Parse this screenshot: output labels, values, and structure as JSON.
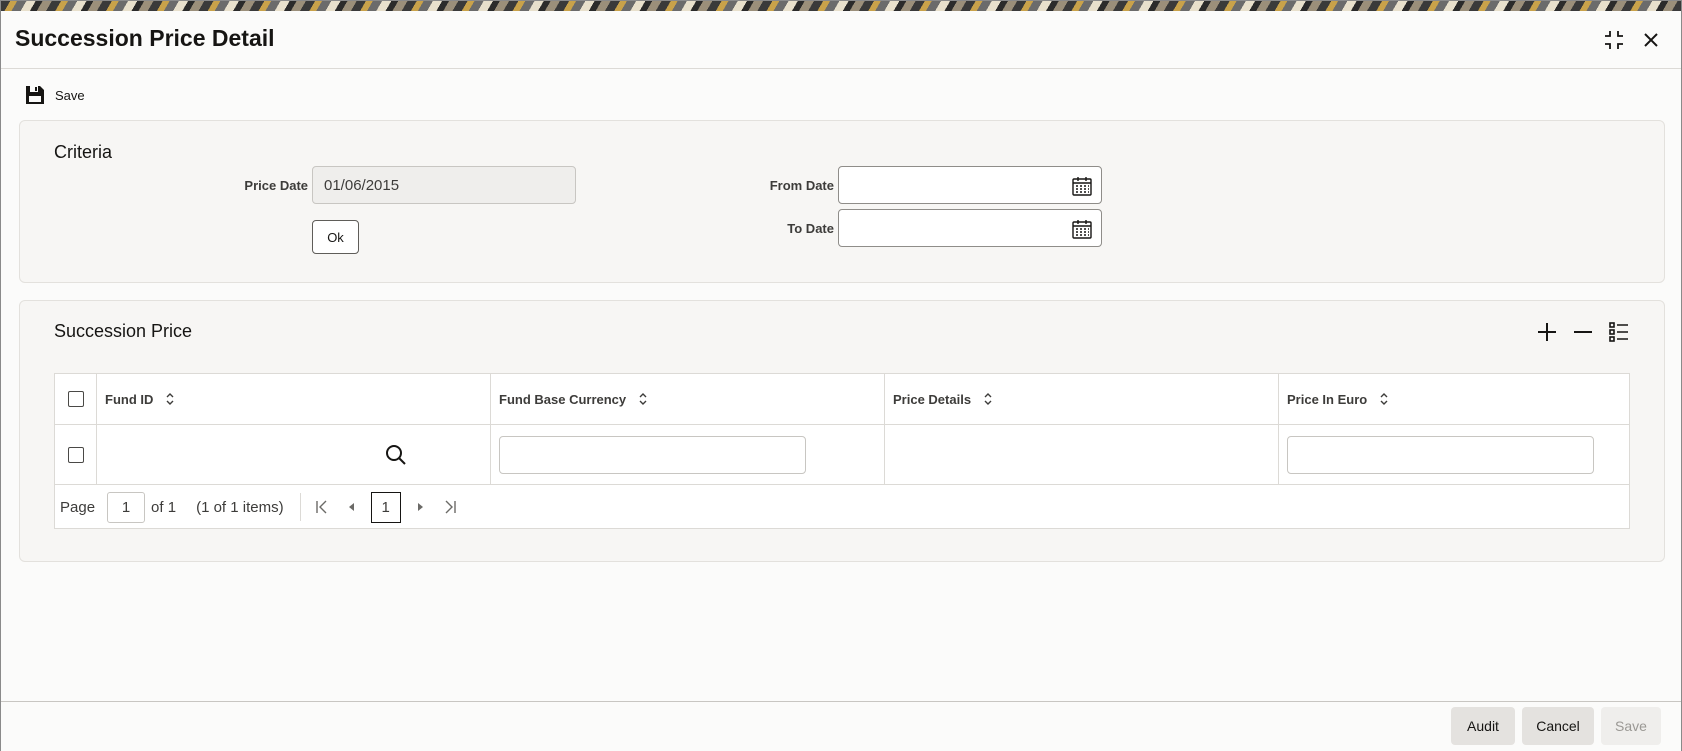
{
  "window": {
    "title": "Succession Price Detail"
  },
  "toolbar": {
    "save_label": "Save"
  },
  "criteria": {
    "title": "Criteria",
    "price_date_label": "Price Date",
    "price_date_value": "01/06/2015",
    "ok_label": "Ok",
    "from_date_label": "From Date",
    "from_date_value": "",
    "to_date_label": "To Date",
    "to_date_value": ""
  },
  "succession": {
    "title": "Succession Price",
    "columns": [
      "Fund ID",
      "Fund Base Currency",
      "Price Details",
      "Price In Euro"
    ],
    "rows": [
      {
        "fund_id": "",
        "fund_base_currency": "",
        "price_details": "",
        "price_in_euro": ""
      }
    ],
    "pager": {
      "page_label": "Page",
      "page_value": "1",
      "of_label": "of 1",
      "items_label": "(1 of 1 items)",
      "current_page": "1"
    }
  },
  "footer": {
    "audit_label": "Audit",
    "cancel_label": "Cancel",
    "save_label": "Save"
  },
  "icons": {
    "maximize": "maximize-icon",
    "close": "close-icon",
    "save": "floppy-disk-icon",
    "calendar": "calendar-icon",
    "add": "plus-icon",
    "remove": "minus-icon",
    "columns": "list-view-icon",
    "search": "search-icon",
    "sort": "sort-icon"
  }
}
